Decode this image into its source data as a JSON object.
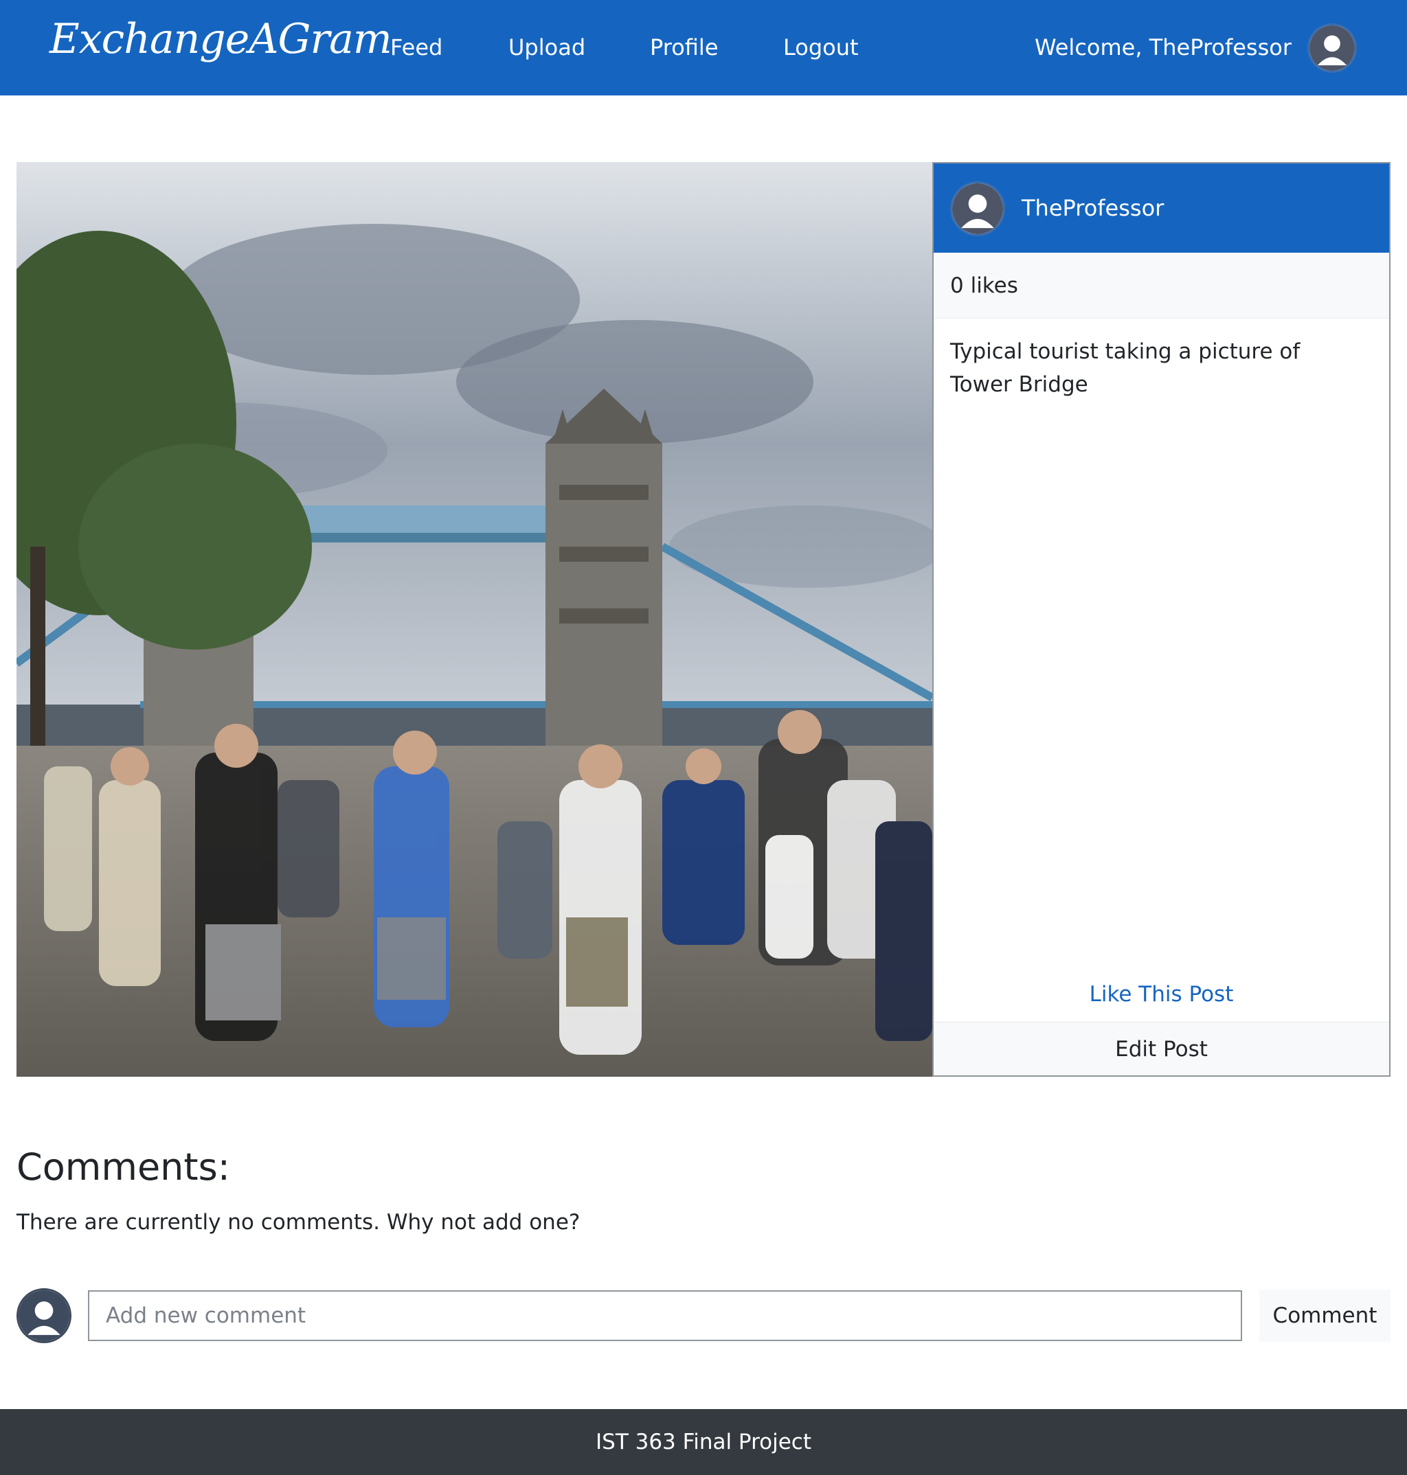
{
  "navbar": {
    "brand": "ExchangeAGram",
    "links": {
      "feed": "Feed",
      "upload": "Upload",
      "profile": "Profile",
      "logout": "Logout"
    },
    "welcome": "Welcome, TheProfessor",
    "avatar_icon": "user-avatar-icon"
  },
  "post": {
    "image_alt": "Tower Bridge with tourists",
    "author": "TheProfessor",
    "likes": "0 likes",
    "caption": "Typical tourist taking a picture of Tower Bridge",
    "like_label": "Like This Post",
    "edit_label": "Edit Post"
  },
  "comments": {
    "title": "Comments:",
    "empty_message": "There are currently no comments. Why not add one?",
    "input_placeholder": "Add new comment",
    "input_value": "",
    "submit_label": "Comment"
  },
  "footer": {
    "text": "IST 363 Final Project"
  },
  "colors": {
    "primary": "#1565c0",
    "footer_bg": "#343a40",
    "light_bg": "#f8f9fa"
  }
}
